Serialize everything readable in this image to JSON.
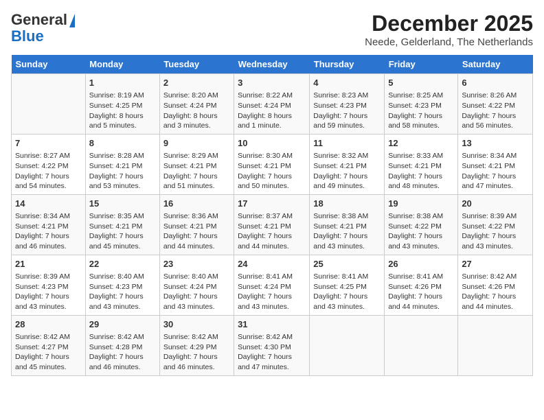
{
  "header": {
    "logo_line1": "General",
    "logo_line2": "Blue",
    "title": "December 2025",
    "subtitle": "Neede, Gelderland, The Netherlands"
  },
  "days_of_week": [
    "Sunday",
    "Monday",
    "Tuesday",
    "Wednesday",
    "Thursday",
    "Friday",
    "Saturday"
  ],
  "weeks": [
    [
      {
        "day": "",
        "sunrise": "",
        "sunset": "",
        "daylight": ""
      },
      {
        "day": "1",
        "sunrise": "Sunrise: 8:19 AM",
        "sunset": "Sunset: 4:25 PM",
        "daylight": "Daylight: 8 hours and 5 minutes."
      },
      {
        "day": "2",
        "sunrise": "Sunrise: 8:20 AM",
        "sunset": "Sunset: 4:24 PM",
        "daylight": "Daylight: 8 hours and 3 minutes."
      },
      {
        "day": "3",
        "sunrise": "Sunrise: 8:22 AM",
        "sunset": "Sunset: 4:24 PM",
        "daylight": "Daylight: 8 hours and 1 minute."
      },
      {
        "day": "4",
        "sunrise": "Sunrise: 8:23 AM",
        "sunset": "Sunset: 4:23 PM",
        "daylight": "Daylight: 7 hours and 59 minutes."
      },
      {
        "day": "5",
        "sunrise": "Sunrise: 8:25 AM",
        "sunset": "Sunset: 4:23 PM",
        "daylight": "Daylight: 7 hours and 58 minutes."
      },
      {
        "day": "6",
        "sunrise": "Sunrise: 8:26 AM",
        "sunset": "Sunset: 4:22 PM",
        "daylight": "Daylight: 7 hours and 56 minutes."
      }
    ],
    [
      {
        "day": "7",
        "sunrise": "Sunrise: 8:27 AM",
        "sunset": "Sunset: 4:22 PM",
        "daylight": "Daylight: 7 hours and 54 minutes."
      },
      {
        "day": "8",
        "sunrise": "Sunrise: 8:28 AM",
        "sunset": "Sunset: 4:21 PM",
        "daylight": "Daylight: 7 hours and 53 minutes."
      },
      {
        "day": "9",
        "sunrise": "Sunrise: 8:29 AM",
        "sunset": "Sunset: 4:21 PM",
        "daylight": "Daylight: 7 hours and 51 minutes."
      },
      {
        "day": "10",
        "sunrise": "Sunrise: 8:30 AM",
        "sunset": "Sunset: 4:21 PM",
        "daylight": "Daylight: 7 hours and 50 minutes."
      },
      {
        "day": "11",
        "sunrise": "Sunrise: 8:32 AM",
        "sunset": "Sunset: 4:21 PM",
        "daylight": "Daylight: 7 hours and 49 minutes."
      },
      {
        "day": "12",
        "sunrise": "Sunrise: 8:33 AM",
        "sunset": "Sunset: 4:21 PM",
        "daylight": "Daylight: 7 hours and 48 minutes."
      },
      {
        "day": "13",
        "sunrise": "Sunrise: 8:34 AM",
        "sunset": "Sunset: 4:21 PM",
        "daylight": "Daylight: 7 hours and 47 minutes."
      }
    ],
    [
      {
        "day": "14",
        "sunrise": "Sunrise: 8:34 AM",
        "sunset": "Sunset: 4:21 PM",
        "daylight": "Daylight: 7 hours and 46 minutes."
      },
      {
        "day": "15",
        "sunrise": "Sunrise: 8:35 AM",
        "sunset": "Sunset: 4:21 PM",
        "daylight": "Daylight: 7 hours and 45 minutes."
      },
      {
        "day": "16",
        "sunrise": "Sunrise: 8:36 AM",
        "sunset": "Sunset: 4:21 PM",
        "daylight": "Daylight: 7 hours and 44 minutes."
      },
      {
        "day": "17",
        "sunrise": "Sunrise: 8:37 AM",
        "sunset": "Sunset: 4:21 PM",
        "daylight": "Daylight: 7 hours and 44 minutes."
      },
      {
        "day": "18",
        "sunrise": "Sunrise: 8:38 AM",
        "sunset": "Sunset: 4:21 PM",
        "daylight": "Daylight: 7 hours and 43 minutes."
      },
      {
        "day": "19",
        "sunrise": "Sunrise: 8:38 AM",
        "sunset": "Sunset: 4:22 PM",
        "daylight": "Daylight: 7 hours and 43 minutes."
      },
      {
        "day": "20",
        "sunrise": "Sunrise: 8:39 AM",
        "sunset": "Sunset: 4:22 PM",
        "daylight": "Daylight: 7 hours and 43 minutes."
      }
    ],
    [
      {
        "day": "21",
        "sunrise": "Sunrise: 8:39 AM",
        "sunset": "Sunset: 4:23 PM",
        "daylight": "Daylight: 7 hours and 43 minutes."
      },
      {
        "day": "22",
        "sunrise": "Sunrise: 8:40 AM",
        "sunset": "Sunset: 4:23 PM",
        "daylight": "Daylight: 7 hours and 43 minutes."
      },
      {
        "day": "23",
        "sunrise": "Sunrise: 8:40 AM",
        "sunset": "Sunset: 4:24 PM",
        "daylight": "Daylight: 7 hours and 43 minutes."
      },
      {
        "day": "24",
        "sunrise": "Sunrise: 8:41 AM",
        "sunset": "Sunset: 4:24 PM",
        "daylight": "Daylight: 7 hours and 43 minutes."
      },
      {
        "day": "25",
        "sunrise": "Sunrise: 8:41 AM",
        "sunset": "Sunset: 4:25 PM",
        "daylight": "Daylight: 7 hours and 43 minutes."
      },
      {
        "day": "26",
        "sunrise": "Sunrise: 8:41 AM",
        "sunset": "Sunset: 4:26 PM",
        "daylight": "Daylight: 7 hours and 44 minutes."
      },
      {
        "day": "27",
        "sunrise": "Sunrise: 8:42 AM",
        "sunset": "Sunset: 4:26 PM",
        "daylight": "Daylight: 7 hours and 44 minutes."
      }
    ],
    [
      {
        "day": "28",
        "sunrise": "Sunrise: 8:42 AM",
        "sunset": "Sunset: 4:27 PM",
        "daylight": "Daylight: 7 hours and 45 minutes."
      },
      {
        "day": "29",
        "sunrise": "Sunrise: 8:42 AM",
        "sunset": "Sunset: 4:28 PM",
        "daylight": "Daylight: 7 hours and 46 minutes."
      },
      {
        "day": "30",
        "sunrise": "Sunrise: 8:42 AM",
        "sunset": "Sunset: 4:29 PM",
        "daylight": "Daylight: 7 hours and 46 minutes."
      },
      {
        "day": "31",
        "sunrise": "Sunrise: 8:42 AM",
        "sunset": "Sunset: 4:30 PM",
        "daylight": "Daylight: 7 hours and 47 minutes."
      },
      {
        "day": "",
        "sunrise": "",
        "sunset": "",
        "daylight": ""
      },
      {
        "day": "",
        "sunrise": "",
        "sunset": "",
        "daylight": ""
      },
      {
        "day": "",
        "sunrise": "",
        "sunset": "",
        "daylight": ""
      }
    ]
  ]
}
